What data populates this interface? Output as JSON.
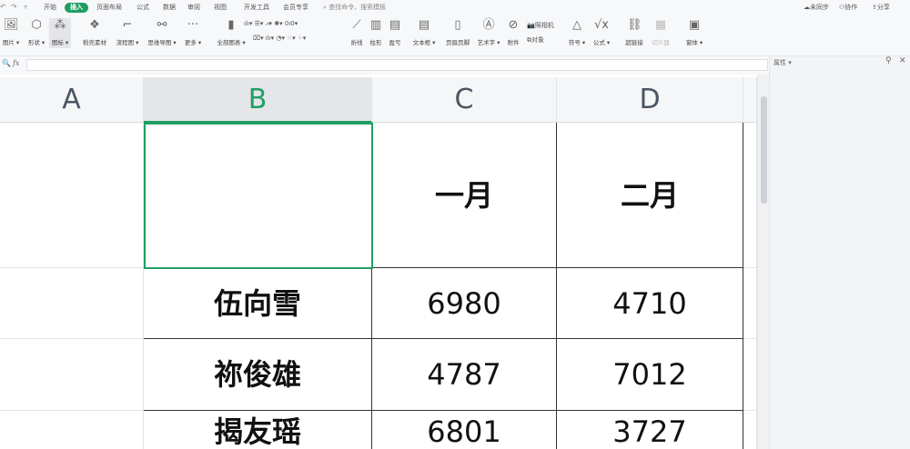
{
  "quick_access": [
    "↶",
    "↷",
    "▿"
  ],
  "tabs": [
    "开始",
    "插入",
    "页面布局",
    "公式",
    "数据",
    "审阅",
    "视图",
    "开发工具",
    "会员专享"
  ],
  "active_tab": "插入",
  "search_placeholder": "查找命令、搜索模板",
  "top_right": {
    "sync": "未同步",
    "collab": "协作",
    "share": "分享"
  },
  "ribbon": {
    "items": [
      {
        "label": "图片 ▾",
        "icon": "image-icon",
        "glyph": "🖼"
      },
      {
        "label": "形状 ▾",
        "icon": "shapes-icon",
        "glyph": "⬡"
      },
      {
        "label": "图标 ▾",
        "icon": "icons-icon",
        "glyph": "⁂"
      },
      {
        "label": "稻壳素材",
        "icon": "material-icon",
        "glyph": "❖"
      },
      {
        "label": "流程图 ▾",
        "icon": "flowchart-icon",
        "glyph": "⌐"
      },
      {
        "label": "思维导图 ▾",
        "icon": "mindmap-icon",
        "glyph": "⚯"
      },
      {
        "label": "更多 ▾",
        "icon": "more-icon",
        "glyph": "···"
      },
      {
        "label": "全部图表 ▾",
        "icon": "all-charts-icon",
        "glyph": "▮"
      },
      {
        "label": "折线",
        "icon": "sparkline-line-icon",
        "glyph": "⟋"
      },
      {
        "label": "柱形",
        "icon": "sparkline-column-icon",
        "glyph": "▥"
      },
      {
        "label": "盈亏",
        "icon": "sparkline-winloss-icon",
        "glyph": "▤"
      },
      {
        "label": "文本框 ▾",
        "icon": "textbox-icon",
        "glyph": "▤"
      },
      {
        "label": "页眉页脚",
        "icon": "header-footer-icon",
        "glyph": "▯"
      },
      {
        "label": "艺术字 ▾",
        "icon": "wordart-icon",
        "glyph": "Ⓐ"
      },
      {
        "label": "附件",
        "icon": "attachment-icon",
        "glyph": "⊘"
      },
      {
        "label": "符号 ▾",
        "icon": "symbol-icon",
        "glyph": "△"
      },
      {
        "label": "公式 ▾",
        "icon": "equation-icon",
        "glyph": "√x"
      },
      {
        "label": "超链接",
        "icon": "hyperlink-icon",
        "glyph": "⛓"
      },
      {
        "label": "切片器",
        "icon": "slicer-icon",
        "glyph": "▦"
      },
      {
        "label": "窗体 ▾",
        "icon": "form-icon",
        "glyph": "▣"
      }
    ],
    "small": {
      "camera": "照相机",
      "object": "对象",
      "charts_row1": "ılı▾ ☰▾ ⩘▾ ✺▾ 0ı0▾",
      "charts_row2": "⌧▾ ılı▾ ◔▾ ⁙▾ ⁘▾"
    }
  },
  "formula_bar": {
    "fx": "fx",
    "zoom": "🔍",
    "value": ""
  },
  "panel": {
    "title": "属性 ▾",
    "pin": "⚲",
    "close": "✕"
  },
  "columns": [
    "A",
    "B",
    "C",
    "D"
  ],
  "selected_column": "B",
  "rows": [
    [
      "",
      "",
      "一月",
      "二月"
    ],
    [
      "",
      "伍向雪",
      "6980",
      "4710"
    ],
    [
      "",
      "祢俊雄",
      "4787",
      "7012"
    ],
    [
      "",
      "揭友瑶",
      "6801",
      "3727"
    ]
  ]
}
